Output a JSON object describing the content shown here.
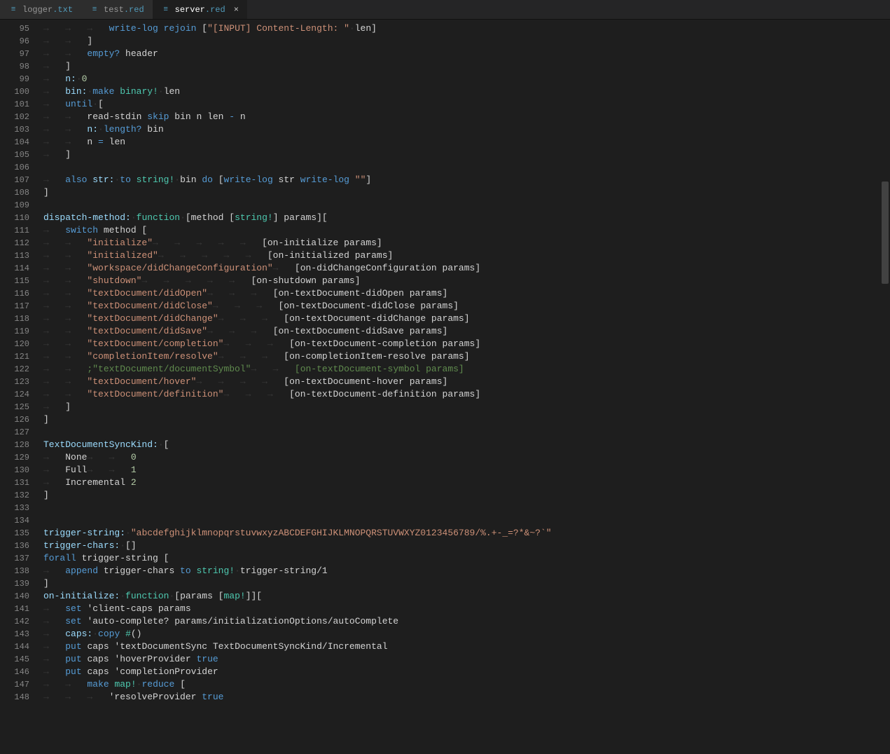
{
  "tabs": [
    {
      "icon": "≡",
      "name": "logger",
      "ext": ".txt",
      "active": false,
      "close": false
    },
    {
      "icon": "≡",
      "name": "test",
      "ext": ".red",
      "active": false,
      "close": false
    },
    {
      "icon": "≡",
      "name": "server",
      "ext": ".red",
      "active": true,
      "close": true
    }
  ],
  "close_glyph": "×",
  "first_line": 95,
  "last_line": 148,
  "scrollbar": {
    "top_pct": 22,
    "height_pct": 14
  },
  "lines": [
    [
      [
        "ws",
        "\t\t\t"
      ],
      [
        "kw",
        "write-log "
      ],
      [
        "kw",
        "rejoin "
      ],
      [
        "pl",
        "["
      ],
      [
        "st",
        "\"[INPUT] Content-Length: \""
      ],
      [
        "ws",
        "·"
      ],
      [
        "pl",
        "len]"
      ]
    ],
    [
      [
        "ws",
        "\t\t"
      ],
      [
        "pl",
        "]"
      ]
    ],
    [
      [
        "ws",
        "\t\t"
      ],
      [
        "kw",
        "empty? "
      ],
      [
        "pl",
        "header"
      ]
    ],
    [
      [
        "ws",
        "\t"
      ],
      [
        "pl",
        "]"
      ]
    ],
    [
      [
        "ws",
        "\t"
      ],
      [
        "setw",
        "n:"
      ],
      [
        "ws",
        "·"
      ],
      [
        "num",
        "0"
      ]
    ],
    [
      [
        "ws",
        "\t"
      ],
      [
        "setw",
        "bin:"
      ],
      [
        "ws",
        "·"
      ],
      [
        "kw",
        "make "
      ],
      [
        "fn",
        "binary!"
      ],
      [
        "ws",
        "·"
      ],
      [
        "pl",
        "len"
      ]
    ],
    [
      [
        "ws",
        "\t"
      ],
      [
        "kw",
        "until"
      ],
      [
        "ws",
        "·"
      ],
      [
        "pl",
        "["
      ]
    ],
    [
      [
        "ws",
        "\t\t"
      ],
      [
        "pl",
        "read-stdin "
      ],
      [
        "kw",
        "skip "
      ],
      [
        "pl",
        "bin n len "
      ],
      [
        "kw",
        "- "
      ],
      [
        "pl",
        "n"
      ]
    ],
    [
      [
        "ws",
        "\t\t"
      ],
      [
        "setw",
        "n:"
      ],
      [
        "ws",
        "·"
      ],
      [
        "kw",
        "length? "
      ],
      [
        "pl",
        "bin"
      ]
    ],
    [
      [
        "ws",
        "\t\t"
      ],
      [
        "pl",
        "n "
      ],
      [
        "kw",
        "= "
      ],
      [
        "pl",
        "len"
      ]
    ],
    [
      [
        "ws",
        "\t"
      ],
      [
        "pl",
        "]"
      ]
    ],
    [
      [
        "pl",
        ""
      ]
    ],
    [
      [
        "ws",
        "\t"
      ],
      [
        "kw",
        "also "
      ],
      [
        "setw",
        "str:"
      ],
      [
        "ws",
        "·"
      ],
      [
        "kw",
        "to "
      ],
      [
        "fn",
        "string!"
      ],
      [
        "ws",
        "·"
      ],
      [
        "pl",
        "bin "
      ],
      [
        "kw",
        "do "
      ],
      [
        "pl",
        "["
      ],
      [
        "kw",
        "write-log "
      ],
      [
        "pl",
        "str "
      ],
      [
        "kw",
        "write-log "
      ],
      [
        "st",
        "\"\""
      ],
      [
        "pl",
        "]"
      ]
    ],
    [
      [
        "pl",
        "]"
      ]
    ],
    [
      [
        "pl",
        ""
      ]
    ],
    [
      [
        "setw",
        "dispatch-method:"
      ],
      [
        "ws",
        "·"
      ],
      [
        "fn",
        "function"
      ],
      [
        "ws",
        "·"
      ],
      [
        "pl",
        "[method ["
      ],
      [
        "fn",
        "string!"
      ],
      [
        "pl",
        "] params]["
      ]
    ],
    [
      [
        "ws",
        "\t"
      ],
      [
        "kw",
        "switch "
      ],
      [
        "pl",
        "method ["
      ]
    ],
    [
      [
        "ws",
        "\t\t"
      ],
      [
        "st",
        "\"initialize\""
      ],
      [
        "ws",
        "\t\t\t\t\t"
      ],
      [
        "pl",
        "[on-initialize params]"
      ]
    ],
    [
      [
        "ws",
        "\t\t"
      ],
      [
        "st",
        "\"initialized\""
      ],
      [
        "ws",
        "\t\t\t\t\t"
      ],
      [
        "pl",
        "[on-initialized params]"
      ]
    ],
    [
      [
        "ws",
        "\t\t"
      ],
      [
        "st",
        "\"workspace/didChangeConfiguration\""
      ],
      [
        "ws",
        "\t"
      ],
      [
        "pl",
        "[on-didChangeConfiguration params]"
      ]
    ],
    [
      [
        "ws",
        "\t\t"
      ],
      [
        "st",
        "\"shutdown\""
      ],
      [
        "ws",
        "\t\t\t\t\t"
      ],
      [
        "pl",
        "[on-shutdown params]"
      ]
    ],
    [
      [
        "ws",
        "\t\t"
      ],
      [
        "st",
        "\"textDocument/didOpen\""
      ],
      [
        "ws",
        "\t\t\t"
      ],
      [
        "pl",
        "[on-textDocument-didOpen params]"
      ]
    ],
    [
      [
        "ws",
        "\t\t"
      ],
      [
        "st",
        "\"textDocument/didClose\""
      ],
      [
        "ws",
        "\t\t\t"
      ],
      [
        "pl",
        "[on-textDocument-didClose params]"
      ]
    ],
    [
      [
        "ws",
        "\t\t"
      ],
      [
        "st",
        "\"textDocument/didChange\""
      ],
      [
        "ws",
        "\t\t\t"
      ],
      [
        "pl",
        "[on-textDocument-didChange params]"
      ]
    ],
    [
      [
        "ws",
        "\t\t"
      ],
      [
        "st",
        "\"textDocument/didSave\""
      ],
      [
        "ws",
        "\t\t\t"
      ],
      [
        "pl",
        "[on-textDocument-didSave params]"
      ]
    ],
    [
      [
        "ws",
        "\t\t"
      ],
      [
        "st",
        "\"textDocument/completion\""
      ],
      [
        "ws",
        "\t\t\t"
      ],
      [
        "pl",
        "[on-textDocument-completion params]"
      ]
    ],
    [
      [
        "ws",
        "\t\t"
      ],
      [
        "st",
        "\"completionItem/resolve\""
      ],
      [
        "ws",
        "\t\t\t"
      ],
      [
        "pl",
        "[on-completionItem-resolve params]"
      ]
    ],
    [
      [
        "ws",
        "\t\t"
      ],
      [
        "cmt",
        ";\"textDocument/documentSymbol\""
      ],
      [
        "ws",
        "\t\t"
      ],
      [
        "cmt",
        "[on-textDocument-symbol params]"
      ]
    ],
    [
      [
        "ws",
        "\t\t"
      ],
      [
        "st",
        "\"textDocument/hover\""
      ],
      [
        "ws",
        "\t\t\t\t"
      ],
      [
        "pl",
        "[on-textDocument-hover params]"
      ]
    ],
    [
      [
        "ws",
        "\t\t"
      ],
      [
        "st",
        "\"textDocument/definition\""
      ],
      [
        "ws",
        "\t\t\t"
      ],
      [
        "pl",
        "[on-textDocument-definition params]"
      ]
    ],
    [
      [
        "ws",
        "\t"
      ],
      [
        "pl",
        "]"
      ]
    ],
    [
      [
        "pl",
        "]"
      ]
    ],
    [
      [
        "pl",
        ""
      ]
    ],
    [
      [
        "setw",
        "TextDocumentSyncKind:"
      ],
      [
        "ws",
        "·"
      ],
      [
        "pl",
        "["
      ]
    ],
    [
      [
        "ws",
        "\t"
      ],
      [
        "pl",
        "None"
      ],
      [
        "ws",
        "\t\t"
      ],
      [
        "num",
        "0"
      ]
    ],
    [
      [
        "ws",
        "\t"
      ],
      [
        "pl",
        "Full"
      ],
      [
        "ws",
        "\t\t"
      ],
      [
        "num",
        "1"
      ]
    ],
    [
      [
        "ws",
        "\t"
      ],
      [
        "pl",
        "Incremental "
      ],
      [
        "num",
        "2"
      ]
    ],
    [
      [
        "pl",
        "]"
      ]
    ],
    [
      [
        "pl",
        ""
      ]
    ],
    [
      [
        "pl",
        ""
      ]
    ],
    [
      [
        "setw",
        "trigger-string:"
      ],
      [
        "ws",
        "·"
      ],
      [
        "st",
        "\"abcdefghijklmnopqrstuvwxyzABCDEFGHIJKLMNOPQRSTUVWXYZ0123456789/%.+-_=?*&~?`\""
      ]
    ],
    [
      [
        "setw",
        "trigger-chars:"
      ],
      [
        "ws",
        "·"
      ],
      [
        "pl",
        "[]"
      ]
    ],
    [
      [
        "kw",
        "forall "
      ],
      [
        "pl",
        "trigger-string ["
      ]
    ],
    [
      [
        "ws",
        "\t"
      ],
      [
        "kw",
        "append "
      ],
      [
        "pl",
        "trigger-chars "
      ],
      [
        "kw",
        "to "
      ],
      [
        "fn",
        "string!"
      ],
      [
        "ws",
        "·"
      ],
      [
        "pl",
        "trigger-string/1"
      ]
    ],
    [
      [
        "pl",
        "]"
      ]
    ],
    [
      [
        "setw",
        "on-initialize:"
      ],
      [
        "ws",
        "·"
      ],
      [
        "fn",
        "function"
      ],
      [
        "ws",
        "·"
      ],
      [
        "pl",
        "[params ["
      ],
      [
        "fn",
        "map!"
      ],
      [
        "pl",
        "]]["
      ]
    ],
    [
      [
        "ws",
        "\t"
      ],
      [
        "kw",
        "set "
      ],
      [
        "pl",
        "'client-caps params"
      ]
    ],
    [
      [
        "ws",
        "\t"
      ],
      [
        "kw",
        "set "
      ],
      [
        "pl",
        "'auto-complete? params/initializationOptions/autoComplete"
      ]
    ],
    [
      [
        "ws",
        "\t"
      ],
      [
        "setw",
        "caps:"
      ],
      [
        "ws",
        "·"
      ],
      [
        "kw",
        "copy "
      ],
      [
        "fn",
        "#"
      ],
      [
        "pl",
        "()"
      ]
    ],
    [
      [
        "ws",
        "\t"
      ],
      [
        "kw",
        "put "
      ],
      [
        "pl",
        "caps 'textDocumentSync TextDocumentSyncKind/Incremental"
      ]
    ],
    [
      [
        "ws",
        "\t"
      ],
      [
        "kw",
        "put "
      ],
      [
        "pl",
        "caps 'hoverProvider "
      ],
      [
        "kw",
        "true"
      ]
    ],
    [
      [
        "ws",
        "\t"
      ],
      [
        "kw",
        "put "
      ],
      [
        "pl",
        "caps 'completionProvider"
      ]
    ],
    [
      [
        "ws",
        "\t\t"
      ],
      [
        "kw",
        "make "
      ],
      [
        "fn",
        "map!"
      ],
      [
        "ws",
        "·"
      ],
      [
        "kw",
        "reduce "
      ],
      [
        "pl",
        "["
      ]
    ],
    [
      [
        "ws",
        "\t\t\t"
      ],
      [
        "pl",
        "'resolveProvider "
      ],
      [
        "kw",
        "true"
      ]
    ]
  ],
  "arrow": "→",
  "dot": "·",
  "tab_spaces": "    "
}
